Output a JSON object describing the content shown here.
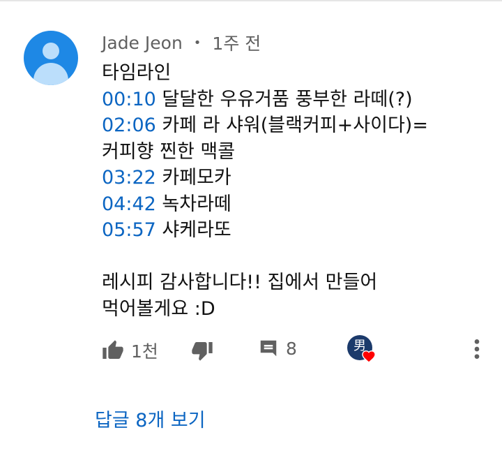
{
  "comment": {
    "author": "Jade Jeon",
    "separator": "•",
    "time": "1주 전",
    "lines": [
      {
        "ts": "",
        "text": "타임라인"
      },
      {
        "ts": "00:10",
        "text": " 달달한 우유거품 풍부한 라떼(?)"
      },
      {
        "ts": "02:06",
        "text": " 카페 라 샤워(블랙커피+사이다)="
      },
      {
        "ts": "",
        "text": "커피향 찐한 맥콜"
      },
      {
        "ts": "03:22",
        "text": " 카페모카"
      },
      {
        "ts": "04:42",
        "text": " 녹차라떼"
      },
      {
        "ts": "05:57",
        "text": " 샤케라또"
      }
    ],
    "closing_lines": [
      "레시피 감사합니다!! 집에서 만들어",
      "먹어볼게요 :D"
    ],
    "likes": "1천",
    "replies_count": "8",
    "hearted_badge": "男",
    "view_replies": "답글 8개 보기"
  },
  "colors": {
    "link": "#0b65c2",
    "meta": "#606060",
    "avatar_bg": "#1e88e5",
    "heart": "#ff0000"
  },
  "icons": [
    "avatar-placeholder-icon",
    "thumbs-up-icon",
    "thumbs-down-icon",
    "reply-icon",
    "creator-heart-icon",
    "more-vert-icon"
  ]
}
